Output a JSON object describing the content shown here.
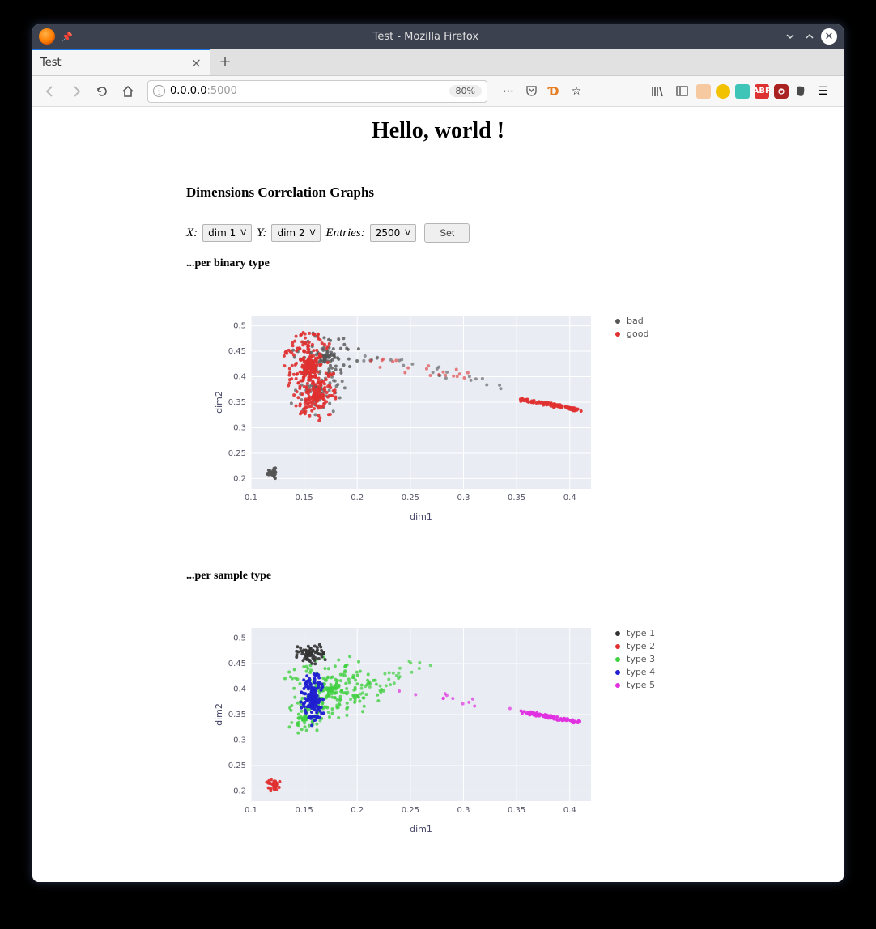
{
  "window": {
    "title": "Test - Mozilla Firefox"
  },
  "tab": {
    "label": "Test"
  },
  "address": {
    "host": "0.0.0.0",
    "port": ":5000",
    "zoom": "80%"
  },
  "page": {
    "heading": "Hello, world !",
    "section_title": "Dimensions Correlation Graphs",
    "controls": {
      "x_label": "X:",
      "x_value": "dim 1",
      "y_label": "Y:",
      "y_value": "dim 2",
      "entries_label": "Entries:",
      "entries_value": "2500",
      "set_button": "Set"
    },
    "chart1_title": "...per binary type",
    "chart2_title": "...per sample type"
  },
  "chart_data": [
    {
      "type": "scatter",
      "title": "...per binary type",
      "xlabel": "dim1",
      "ylabel": "dim2",
      "xlim": [
        0.1,
        0.42
      ],
      "ylim": [
        0.18,
        0.52
      ],
      "x_ticks": [
        0.1,
        0.15,
        0.2,
        0.25,
        0.3,
        0.35,
        0.4
      ],
      "y_ticks": [
        0.2,
        0.25,
        0.3,
        0.35,
        0.4,
        0.45,
        0.5
      ],
      "series": [
        {
          "name": "bad",
          "color": "#555555"
        },
        {
          "name": "good",
          "color": "#e03030"
        }
      ],
      "clusters_description": "Dense red+grey cluster at x≈0.13–0.20, y≈0.30–0.50 (main blob). Small black cluster at x≈0.12, y≈0.20–0.22. Sparse scatter extending x 0.20–0.35, y≈0.35–0.45. Tight red diagonal streak at x≈0.35–0.41, y≈0.33–0.36."
    },
    {
      "type": "scatter",
      "title": "...per sample type",
      "xlabel": "dim1",
      "ylabel": "dim2",
      "xlim": [
        0.1,
        0.42
      ],
      "ylim": [
        0.18,
        0.52
      ],
      "x_ticks": [
        0.1,
        0.15,
        0.2,
        0.25,
        0.3,
        0.35,
        0.4
      ],
      "y_ticks": [
        0.2,
        0.25,
        0.3,
        0.35,
        0.4,
        0.45,
        0.5
      ],
      "series": [
        {
          "name": "type 1",
          "color": "#333333"
        },
        {
          "name": "type 2",
          "color": "#e03030"
        },
        {
          "name": "type 3",
          "color": "#40d040"
        },
        {
          "name": "type 4",
          "color": "#2020d0"
        },
        {
          "name": "type 5",
          "color": "#e030e0"
        }
      ],
      "clusters_description": "Black cluster x≈0.14–0.17, y≈0.45–0.50. Dense blue vertical cluster x≈0.15–0.17, y≈0.32–0.43. Green spreading cluster x≈0.13–0.26, y≈0.30–0.47. Small red cluster x≈0.12, y≈0.20–0.22. Magenta diagonal streak x≈0.35–0.41, y≈0.33–0.36 plus sparse magenta points x 0.24–0.34."
    }
  ]
}
